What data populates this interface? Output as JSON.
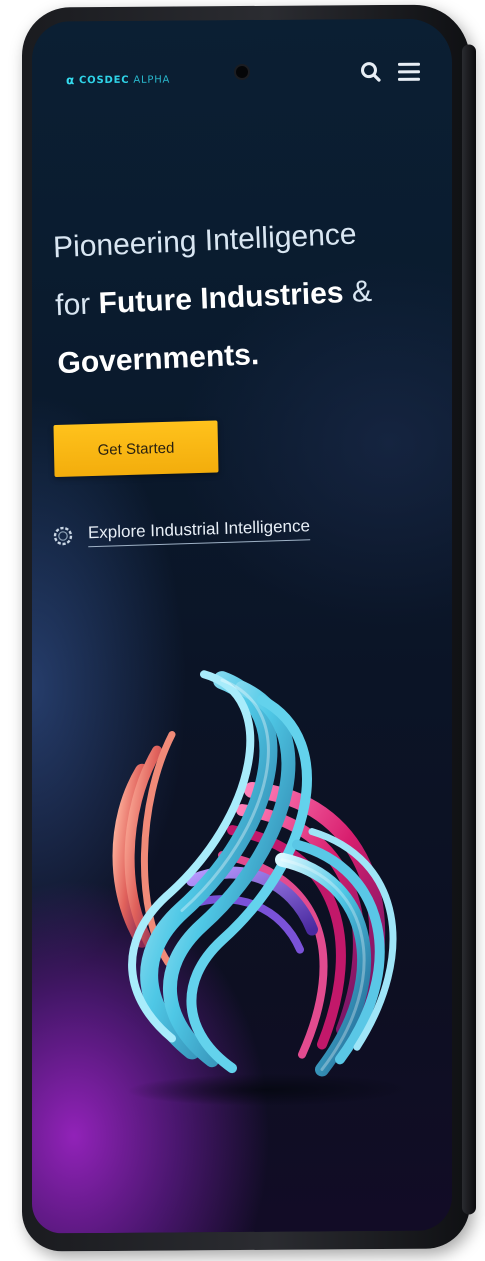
{
  "brand": {
    "logo_mark": "α",
    "logo_name": "COSDEC",
    "logo_suffix": "ALPHA",
    "accent_color": "#2fd3e8",
    "cta_color": "#f7b514"
  },
  "header": {
    "search_icon": "search-icon",
    "menu_icon": "hamburger-menu-icon"
  },
  "hero": {
    "line1": "Pioneering Intelligence",
    "line2_prefix": "for ",
    "line2_bold": "Future Industries",
    "line2_suffix": " &",
    "line3": "Governments."
  },
  "cta": {
    "label": "Get Started"
  },
  "explore": {
    "icon": "spinner-icon",
    "label": "Explore Industrial Intelligence"
  }
}
